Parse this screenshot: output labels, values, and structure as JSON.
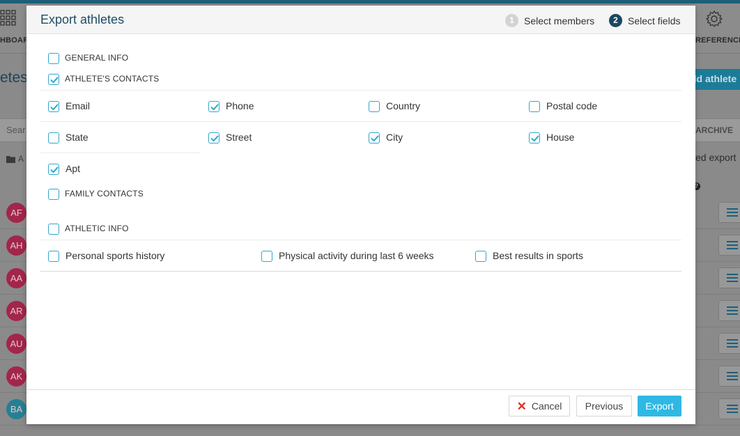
{
  "background": {
    "nav_dashboard_label": "HBOARD",
    "nav_preferences_label": "REFERENCES",
    "page_title": "etes",
    "add_button_label": "dd athlete",
    "search_placeholder": "Sear",
    "archive_label": "ARCHIVE",
    "folder_label": "A",
    "export_link": "ed export",
    "help_icon_label": "?",
    "avatars": [
      {
        "initials": "AF",
        "color": "#a3264a"
      },
      {
        "initials": "AH",
        "color": "#a3264a"
      },
      {
        "initials": "AA",
        "color": "#a3264a"
      },
      {
        "initials": "AR",
        "color": "#a3264a"
      },
      {
        "initials": "AU",
        "color": "#a3264a"
      },
      {
        "initials": "AK",
        "color": "#a3264a"
      },
      {
        "initials": "BA",
        "color": "#277f94"
      }
    ]
  },
  "modal": {
    "title": "Export athletes",
    "steps": [
      {
        "number": "1",
        "label": "Select members",
        "active": false
      },
      {
        "number": "2",
        "label": "Select fields",
        "active": true
      }
    ],
    "sections": {
      "general_info": {
        "label": "GENERAL INFO",
        "checked": false
      },
      "athletes_contacts": {
        "label": "ATHLETE'S CONTACTS",
        "checked": true,
        "fields": [
          {
            "label": "Email",
            "checked": true
          },
          {
            "label": "Phone",
            "checked": true
          },
          {
            "label": "Country",
            "checked": false
          },
          {
            "label": "Postal code",
            "checked": false
          },
          {
            "label": "State",
            "checked": false
          },
          {
            "label": "Street",
            "checked": true
          },
          {
            "label": "City",
            "checked": true
          },
          {
            "label": "House",
            "checked": true
          },
          {
            "label": "Apt",
            "checked": true
          }
        ]
      },
      "family_contacts": {
        "label": "FAMILY CONTACTS",
        "checked": false
      },
      "athletic_info": {
        "label": "ATHLETIC INFO",
        "checked": false,
        "fields": [
          {
            "label": "Personal sports history",
            "checked": false
          },
          {
            "label": "Physical activity during last 6 weeks",
            "checked": false
          },
          {
            "label": "Best results in sports",
            "checked": false
          }
        ]
      }
    },
    "footer": {
      "cancel_label": "Cancel",
      "previous_label": "Previous",
      "export_label": "Export"
    }
  },
  "colors": {
    "accent": "#2fb8e4",
    "checkbox_border": "#2fa7cd",
    "step_active": "#1b4760",
    "step_inactive": "#d3d3d3",
    "cancel_icon": "#d8332c"
  }
}
